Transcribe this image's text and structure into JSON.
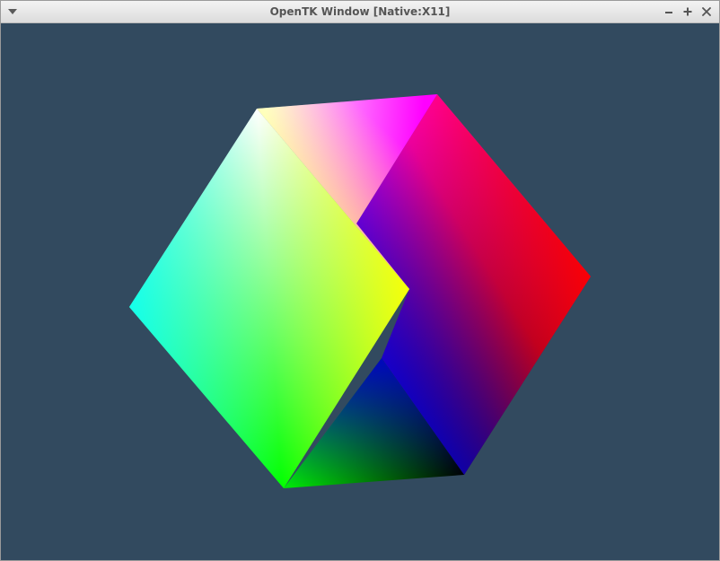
{
  "window": {
    "title": "OpenTK Window [Native:X11]",
    "controls": {
      "menu_icon": "chevron-down-icon",
      "minimize_icon": "minimize-icon",
      "maximize_icon": "maximize-icon",
      "close_icon": "close-icon"
    }
  },
  "scene": {
    "background_color": "#324a5f",
    "object": "rotating color cube",
    "vertex_colors": [
      "#ffffff",
      "#ff00ff",
      "#ff0000",
      "#000000",
      "#00ff00",
      "#00ffff",
      "#ffff00",
      "#0000ff"
    ]
  }
}
